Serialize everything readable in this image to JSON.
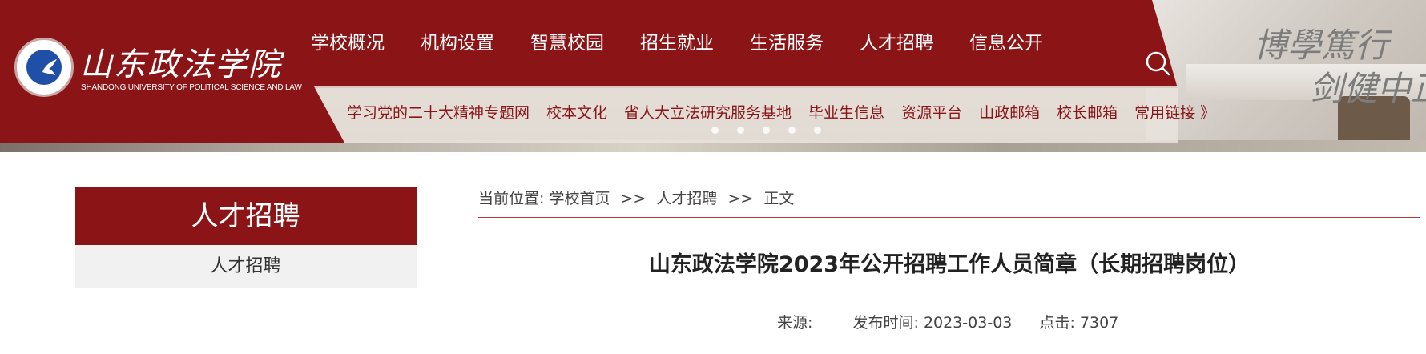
{
  "site": {
    "name_cn": "山东政法学院",
    "name_en": "SHANDONG UNIVERSITY OF POLITICAL SCIENCE AND LAW"
  },
  "main_nav": [
    "学校概况",
    "机构设置",
    "智慧校园",
    "招生就业",
    "生活服务",
    "人才招聘",
    "信息公开"
  ],
  "quick_links": [
    "学习党的二十大精神专题网",
    "校本文化",
    "省人大立法研究服务基地",
    "毕业生信息",
    "资源平台",
    "山政邮箱",
    "校长邮箱",
    "常用链接 》"
  ],
  "banner": {
    "line1": "博學篤行",
    "line2": "剑健中正"
  },
  "sidebar": {
    "title": "人才招聘",
    "items": [
      "人才招聘"
    ]
  },
  "breadcrumb": {
    "prefix": "当前位置:",
    "items": [
      "学校首页",
      "人才招聘",
      "正文"
    ],
    "separator": ">>"
  },
  "article": {
    "title": "山东政法学院2023年公开招聘工作人员简章（长期招聘岗位）",
    "source_label": "来源:",
    "source_value": "",
    "date_label": "发布时间:",
    "date_value": "2023-03-03",
    "clicks_label": "点击:",
    "clicks_value": "7307"
  },
  "colors": {
    "brand_red": "#8b1516"
  }
}
